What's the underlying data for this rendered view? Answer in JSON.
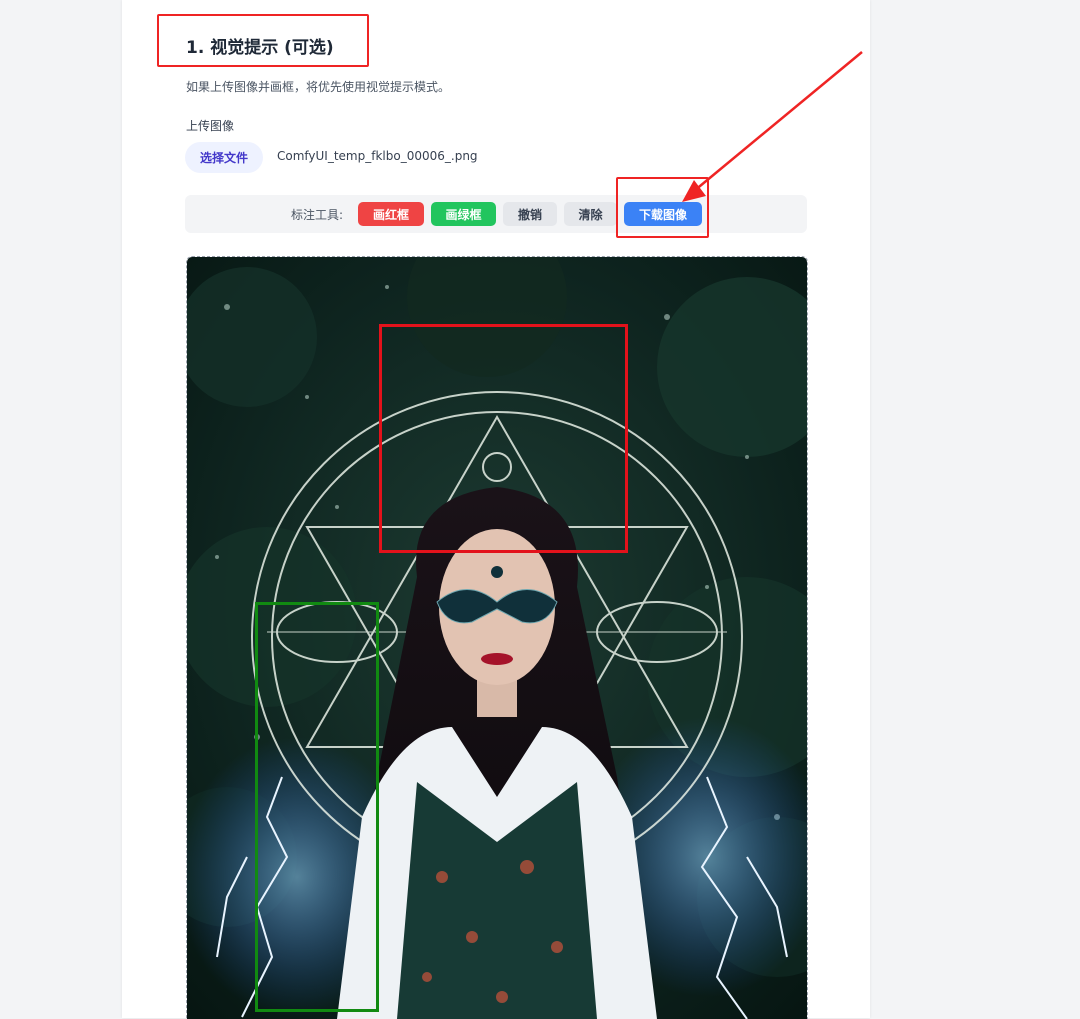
{
  "section": {
    "title": "1. 视觉提示 (可选)",
    "hint": "如果上传图像并画框，将优先使用视觉提示模式。"
  },
  "upload": {
    "label": "上传图像",
    "choose_button": "选择文件",
    "file_name": "ComfyUI_temp_fklbo_00006_.png"
  },
  "toolbar": {
    "label": "标注工具:",
    "draw_red_box": "画红框",
    "draw_green_box": "画绿框",
    "undo": "撤销",
    "clear": "清除",
    "download": "下载图像"
  },
  "canvas": {
    "image_description": "portrait with occult circle and lightning",
    "annotations": [
      {
        "color": "red"
      },
      {
        "color": "green"
      }
    ]
  },
  "colors": {
    "red_button": "#ef4444",
    "green_button": "#22c55e",
    "blue_button": "#3b82f6",
    "callout_red": "#ef2424",
    "annotation_red": "#e3121b",
    "annotation_green": "#118a11"
  }
}
